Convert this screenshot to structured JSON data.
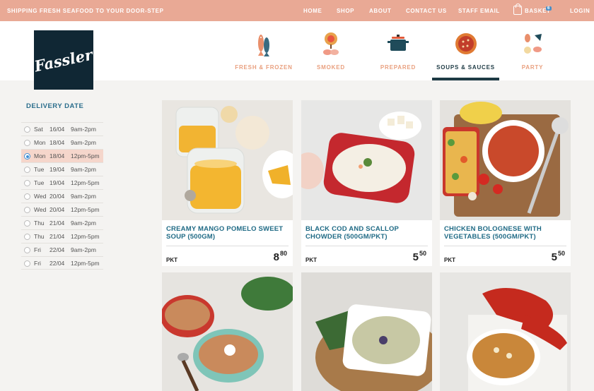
{
  "topbar": {
    "shipping_text": "SHIPPING FRESH SEAFOOD TO YOUR DOOR-STEP",
    "nav": [
      "HOME",
      "SHOP",
      "ABOUT",
      "CONTACT US",
      "STAFF EMAIL"
    ],
    "basket_label": "BASKET",
    "basket_count": "6",
    "login_label": "LOGIN"
  },
  "logo": {
    "text": "Fassler"
  },
  "categories": [
    {
      "label": "FRESH & FROZEN",
      "icon": "fish-icon",
      "active": false
    },
    {
      "label": "SMOKED",
      "icon": "smoked-salmon-icon",
      "active": false
    },
    {
      "label": "PREPARED",
      "icon": "pot-icon",
      "active": false
    },
    {
      "label": "SOUPS & SAUCES",
      "icon": "soup-bowl-icon",
      "active": true
    },
    {
      "label": "PARTY",
      "icon": "party-platter-icon",
      "active": false
    }
  ],
  "delivery": {
    "heading": "DELIVERY DATE",
    "slots": [
      {
        "day": "Sat",
        "date": "16/04",
        "time": "9am-2pm",
        "selected": false
      },
      {
        "day": "Mon",
        "date": "18/04",
        "time": "9am-2pm",
        "selected": false
      },
      {
        "day": "Mon",
        "date": "18/04",
        "time": "12pm-5pm",
        "selected": true
      },
      {
        "day": "Tue",
        "date": "19/04",
        "time": "9am-2pm",
        "selected": false
      },
      {
        "day": "Tue",
        "date": "19/04",
        "time": "12pm-5pm",
        "selected": false
      },
      {
        "day": "Wed",
        "date": "20/04",
        "time": "9am-2pm",
        "selected": false
      },
      {
        "day": "Wed",
        "date": "20/04",
        "time": "12pm-5pm",
        "selected": false
      },
      {
        "day": "Thu",
        "date": "21/04",
        "time": "9am-2pm",
        "selected": false
      },
      {
        "day": "Thu",
        "date": "21/04",
        "time": "12pm-5pm",
        "selected": false
      },
      {
        "day": "Fri",
        "date": "22/04",
        "time": "9am-2pm",
        "selected": false
      },
      {
        "day": "Fri",
        "date": "22/04",
        "time": "12pm-5pm",
        "selected": false
      }
    ]
  },
  "products": [
    {
      "title": "CREAMY MANGO POMELO SWEET SOUP (500GM)",
      "unit": "PKT",
      "price_main": "8",
      "price_cents": "80"
    },
    {
      "title": "BLACK COD AND SCALLOP CHOWDER (500GM/PKT)",
      "unit": "PKT",
      "price_main": "5",
      "price_cents": "50"
    },
    {
      "title": "CHICKEN BOLOGNESE WITH VEGETABLES (500GM/PKT)",
      "unit": "PKT",
      "price_main": "5",
      "price_cents": "50"
    },
    {
      "title": "",
      "unit": "",
      "price_main": "",
      "price_cents": ""
    },
    {
      "title": "",
      "unit": "",
      "price_main": "",
      "price_cents": ""
    },
    {
      "title": "",
      "unit": "",
      "price_main": "",
      "price_cents": ""
    }
  ]
}
